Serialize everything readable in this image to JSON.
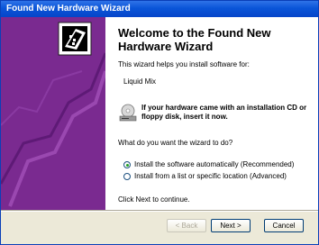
{
  "window": {
    "title": "Found New Hardware Wizard"
  },
  "heading": "Welcome to the Found New Hardware Wizard",
  "intro": "This wizard helps you install software for:",
  "device_name": "Liquid Mix",
  "cd_prompt": "If your hardware came with an installation CD or floppy disk, insert it now.",
  "question": "What do you want the wizard to do?",
  "options": [
    {
      "label": "Install the software automatically (Recommended)",
      "selected": true
    },
    {
      "label": "Install from a list or specific location (Advanced)",
      "selected": false
    }
  ],
  "continue_text": "Click Next to continue.",
  "buttons": {
    "back": "< Back",
    "next": "Next >",
    "cancel": "Cancel"
  },
  "colors": {
    "banner": "#7a2a90",
    "titlebar": "#0a55d8",
    "accent": "#21a121"
  }
}
